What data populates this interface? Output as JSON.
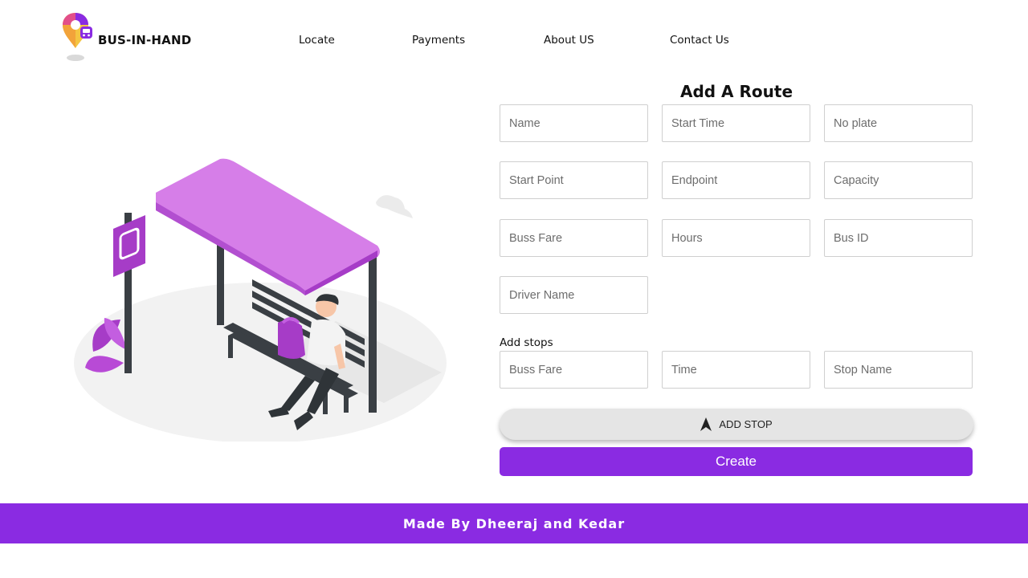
{
  "header": {
    "brand": "BUS-IN-HAND",
    "nav": [
      "Locate",
      "Payments",
      "About US",
      "Contact Us"
    ]
  },
  "form": {
    "title": "Add A Route",
    "fields": {
      "name": "Name",
      "start_time": "Start Time",
      "no_plate": "No plate",
      "start_point": "Start Point",
      "endpoint": "Endpoint",
      "capacity": "Capacity",
      "buss_fare": "Buss Fare",
      "hours": "Hours",
      "bus_id": "Bus ID",
      "driver_name": "Driver Name"
    },
    "stops_label": "Add stops",
    "stop_fields": {
      "buss_fare": "Buss Fare",
      "time": "Time",
      "stop_name": "Stop Name"
    },
    "add_stop_label": "ADD STOP",
    "create_label": "Create"
  },
  "footer": {
    "text": "Made By Dheeraj and Kedar"
  },
  "colors": {
    "accent": "#8a2be2",
    "shelter": "#d67ee8",
    "stop_sign": "#a63cc7"
  },
  "icons": [
    "location-pin-logo-icon",
    "navigation-arrow-icon"
  ]
}
